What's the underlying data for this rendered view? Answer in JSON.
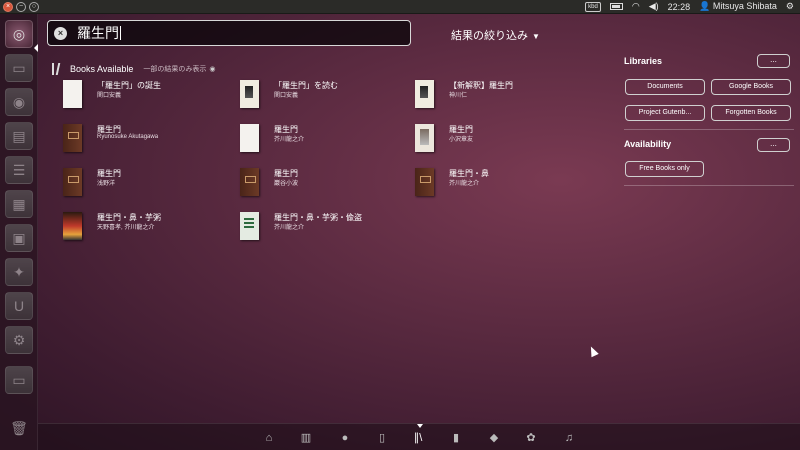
{
  "panel": {
    "window_buttons": [
      "×",
      "−",
      "○"
    ],
    "keyboard_indicator": "kbd",
    "time": "22:28",
    "user": "Mitsuya Shibata"
  },
  "search": {
    "query": "羅生門",
    "filter_label": "結果の絞り込み",
    "filter_arrow": "▼"
  },
  "results": {
    "header": "Books Available",
    "subheader": "一部の結果のみ表示",
    "eye_icon": "◉",
    "books": [
      {
        "title": "「羅生門」の誕生",
        "author": "関口安義",
        "cover": "white"
      },
      {
        "title": "「羅生門」を読む",
        "author": "関口安義",
        "cover": "ink"
      },
      {
        "title": "【新解釈】羅生門",
        "author": "神川仁",
        "cover": "ink"
      },
      {
        "title": "羅生門",
        "author": "Ryunosuke Akutagawa",
        "cover": "brown"
      },
      {
        "title": "羅生門",
        "author": "芥川龍之介",
        "cover": "white"
      },
      {
        "title": "羅生門",
        "author": "小沢章友",
        "cover": "sketch"
      },
      {
        "title": "羅生門",
        "author": "浅野洋",
        "cover": "brown"
      },
      {
        "title": "羅生門",
        "author": "巖谷小波",
        "cover": "brown"
      },
      {
        "title": "羅生門・鼻",
        "author": "芥川龍之介",
        "cover": "brown"
      },
      {
        "title": "羅生門・鼻・芋粥",
        "author": "天野喜孝, 芥川龍之介",
        "cover": "photo"
      },
      {
        "title": "羅生門・鼻・芋粥・偸盗",
        "author": "芥川龍之介",
        "cover": "green"
      }
    ]
  },
  "filters": {
    "libraries_title": "Libraries",
    "more_label": "...",
    "libraries": [
      "Documents",
      "Google Books",
      "Project Gutenb...",
      "Forgotten Books"
    ],
    "availability_title": "Availability",
    "availability": [
      "Free Books only"
    ]
  },
  "launcher_icons": [
    "ubuntu-logo",
    "folder-icon",
    "browser-icon",
    "document-icon",
    "text-document-icon",
    "spreadsheet-icon",
    "presentation-icon",
    "software-center-icon",
    "ubuntu-one-icon",
    "settings-icon",
    "workspace-switcher-icon",
    "trash-icon"
  ],
  "lens_bar_icons": [
    "home-icon",
    "applications-icon",
    "ask-icon",
    "bookmark-icon",
    "books-icon",
    "files-icon",
    "python-icon",
    "photos-icon",
    "music-icon"
  ]
}
